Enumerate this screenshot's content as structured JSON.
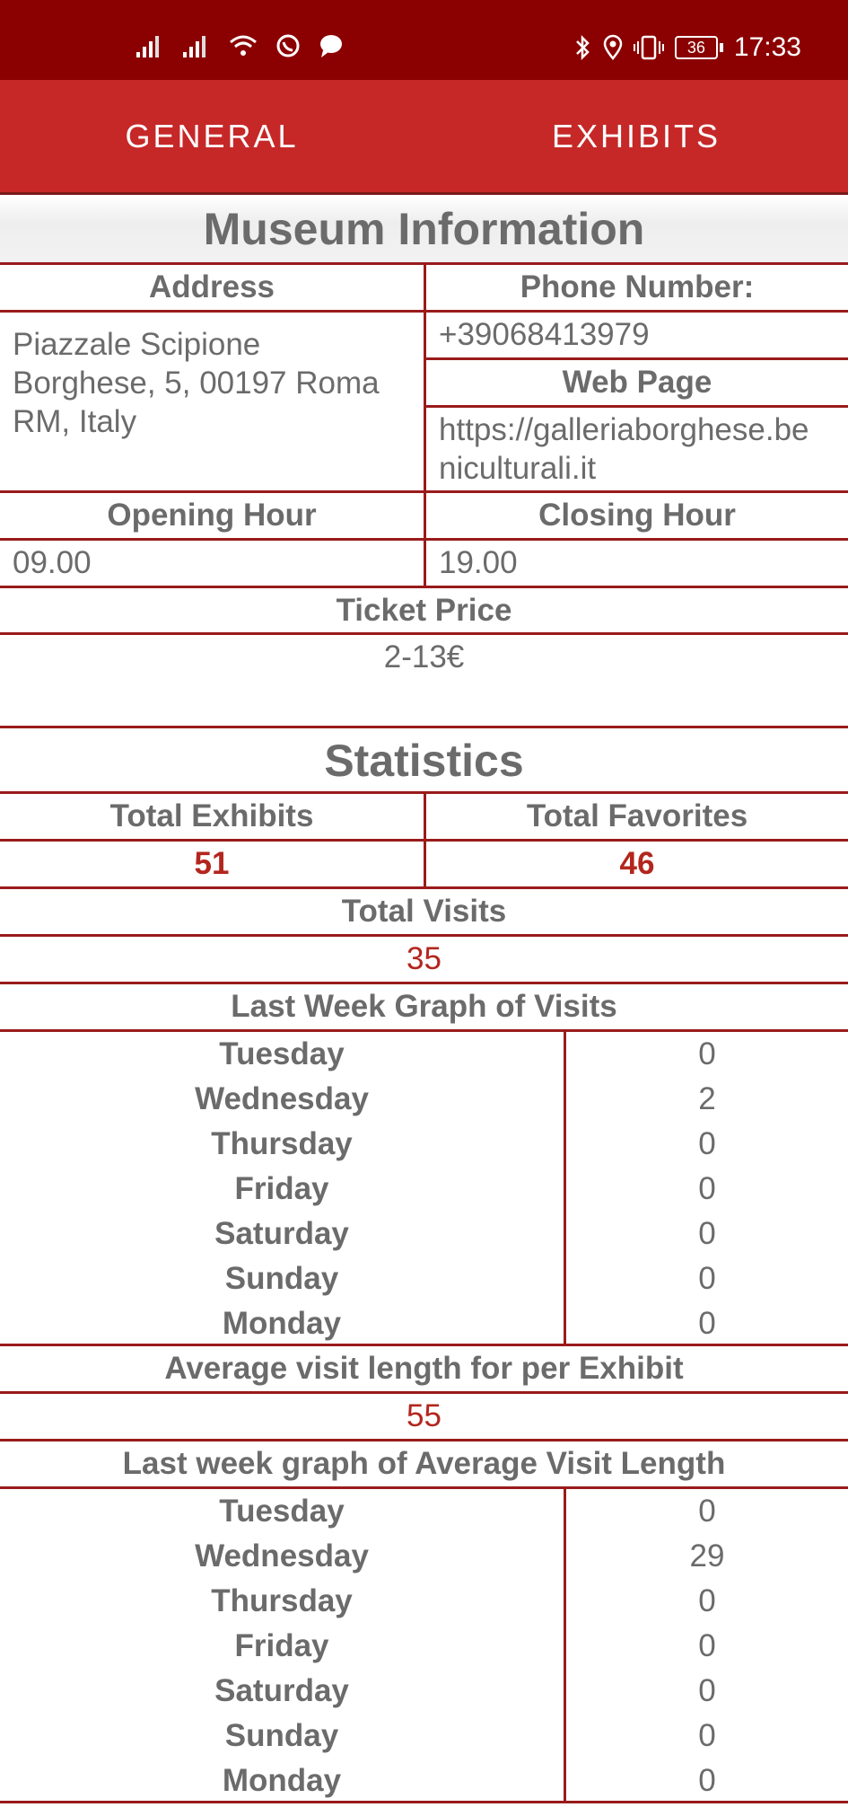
{
  "status_bar": {
    "time": "17:33",
    "battery": "36"
  },
  "tabs": {
    "general": "GENERAL",
    "exhibits": "EXHIBITS"
  },
  "museum": {
    "title": "Museum Information",
    "address_label": "Address",
    "address": "Piazzale Scipione Borghese, 5, 00197 Roma RM, Italy",
    "phone_label": "Phone Number:",
    "phone": "+39068413979",
    "web_label": "Web Page",
    "web": "https://galleriaborghese.beniculturali.it",
    "opening_label": "Opening Hour",
    "opening": "09.00",
    "closing_label": "Closing Hour",
    "closing": "19.00",
    "ticket_label": "Ticket Price",
    "ticket": "2-13€"
  },
  "statistics": {
    "title": "Statistics",
    "total_exhibits_label": "Total Exhibits",
    "total_exhibits": "51",
    "total_favorites_label": "Total Favorites",
    "total_favorites": "46",
    "total_visits_label": "Total Visits",
    "total_visits": "35",
    "visits_graph_label": "Last Week Graph of Visits",
    "visits_week": [
      {
        "day": "Tuesday",
        "value": "0"
      },
      {
        "day": "Wednesday",
        "value": "2"
      },
      {
        "day": "Thursday",
        "value": "0"
      },
      {
        "day": "Friday",
        "value": "0"
      },
      {
        "day": "Saturday",
        "value": "0"
      },
      {
        "day": "Sunday",
        "value": "0"
      },
      {
        "day": "Monday",
        "value": "0"
      }
    ],
    "avg_label": "Average visit length for per Exhibit",
    "avg_value": "55",
    "avg_graph_label": "Last week graph of Average Visit Length",
    "avg_week": [
      {
        "day": "Tuesday",
        "value": "0"
      },
      {
        "day": "Wednesday",
        "value": "29"
      },
      {
        "day": "Thursday",
        "value": "0"
      },
      {
        "day": "Friday",
        "value": "0"
      },
      {
        "day": "Saturday",
        "value": "0"
      },
      {
        "day": "Sunday",
        "value": "0"
      },
      {
        "day": "Monday",
        "value": "0"
      }
    ]
  }
}
